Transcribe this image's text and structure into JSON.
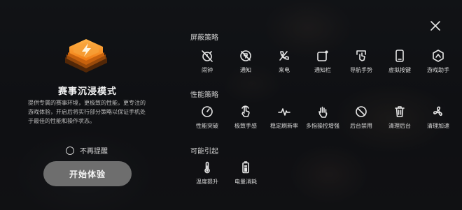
{
  "mode_panel": {
    "title": "赛事沉浸模式",
    "description": "提供专属的赛事环境，更极致的性能，更专注的游戏体验，开启后将实行部分策略以保证手机处于最佳的性能和操作状态。",
    "dont_remind_label": "不再提醒",
    "start_button_label": "开始体验",
    "accent_color": "#f58a1f"
  },
  "sections": {
    "shield": {
      "title": "屏蔽策略",
      "items": [
        {
          "label": "闹钟",
          "icon": "alarm-off-icon"
        },
        {
          "label": "通知",
          "icon": "notification-off-icon"
        },
        {
          "label": "来电",
          "icon": "call-off-icon"
        },
        {
          "label": "通知栏",
          "icon": "notification-bar-icon"
        },
        {
          "label": "导航手势",
          "icon": "navigation-gesture-icon"
        },
        {
          "label": "虚拟按键",
          "icon": "virtual-keys-icon"
        },
        {
          "label": "游戏助手",
          "icon": "game-assistant-icon"
        }
      ]
    },
    "performance": {
      "title": "性能策略",
      "items": [
        {
          "label": "性能突破",
          "icon": "performance-gauge-icon"
        },
        {
          "label": "极致手感",
          "icon": "touch-hand-icon"
        },
        {
          "label": "稳定刷新率",
          "icon": "refresh-rate-icon"
        },
        {
          "label": "多指操控增强",
          "icon": "multi-finger-icon"
        },
        {
          "label": "后台禁用",
          "icon": "background-disabled-icon"
        },
        {
          "label": "清理后台",
          "icon": "trash-icon"
        },
        {
          "label": "清理加速",
          "icon": "fan-icon"
        }
      ]
    },
    "effects": {
      "title": "可能引起",
      "items": [
        {
          "label": "温度提升",
          "icon": "thermometer-icon"
        },
        {
          "label": "电量消耗",
          "icon": "battery-icon"
        }
      ]
    }
  }
}
